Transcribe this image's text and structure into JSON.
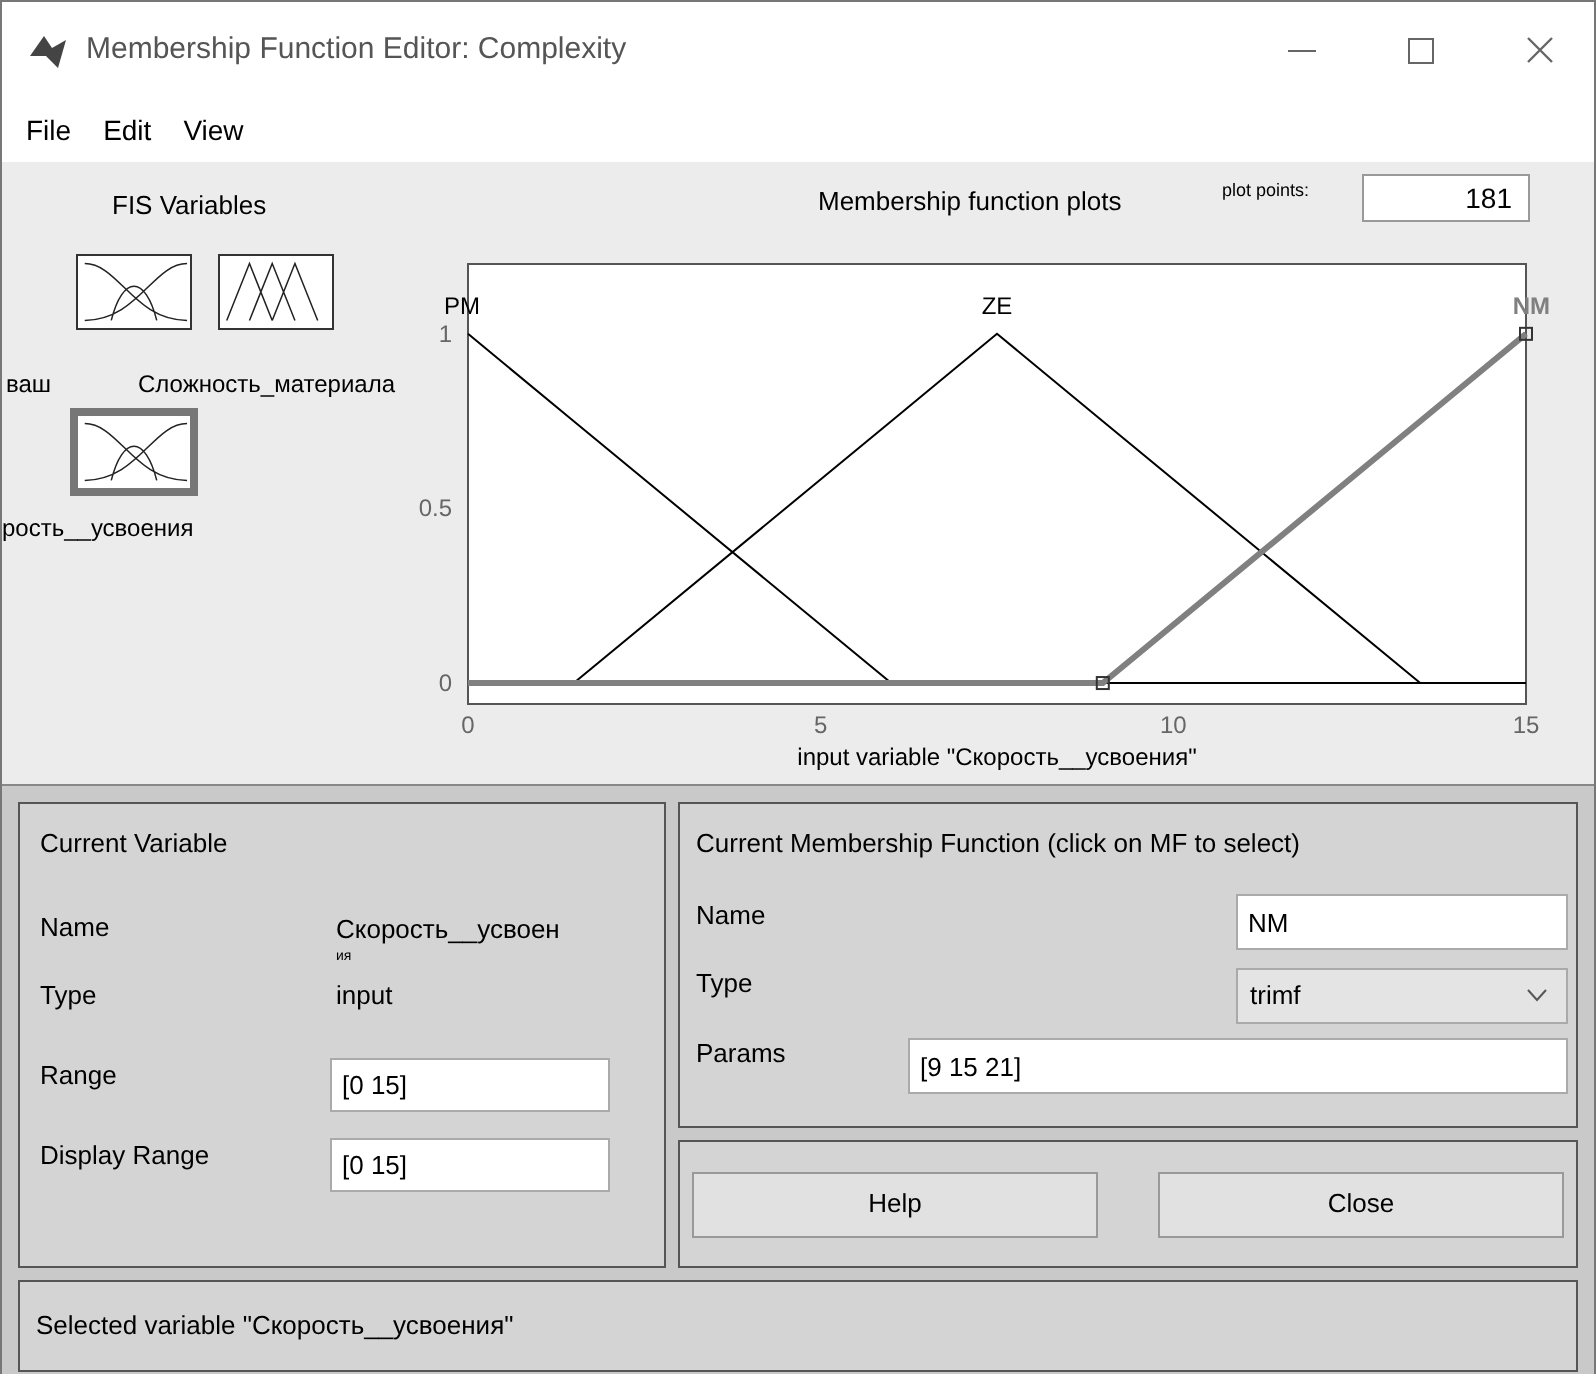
{
  "window": {
    "title": "Membership Function Editor: Complexity"
  },
  "menu": [
    "File",
    "Edit",
    "View"
  ],
  "fis_variables": {
    "title": "FIS Variables",
    "items": [
      {
        "label": "ваш",
        "kind": "input",
        "selected": false
      },
      {
        "label": "Сложность_материала",
        "kind": "output",
        "selected": false
      },
      {
        "label": "рость__усвоения",
        "kind": "input",
        "selected": true
      }
    ]
  },
  "plot": {
    "title": "Membership function plots",
    "plot_points_label": "plot points:",
    "plot_points": "181",
    "membership_functions": [
      {
        "label": "PM",
        "selected": false
      },
      {
        "label": "ZE",
        "selected": false
      },
      {
        "label": "NM",
        "selected": true
      }
    ],
    "chart_data": {
      "type": "line",
      "xlabel": "input variable \"Скорость__усвоения\"",
      "x": [
        0,
        1.5,
        6,
        7.5,
        9,
        13.5,
        15
      ],
      "xlim": [
        0,
        15
      ],
      "ylim": [
        -0.06,
        1.2
      ],
      "xticks": [
        0,
        5,
        10,
        15
      ],
      "yticks": [
        0,
        0.5,
        1
      ],
      "series": [
        {
          "color": "#000000",
          "values": [
            1,
            0.75,
            0,
            0,
            0,
            0,
            0
          ]
        },
        {
          "color": "#000000",
          "values": [
            null,
            0,
            0.75,
            1,
            0.75,
            0,
            null
          ]
        },
        {
          "color": "#808080",
          "values": [
            0,
            0,
            0,
            0,
            0,
            0.75,
            1
          ]
        }
      ]
    }
  },
  "current_variable": {
    "title": "Current Variable",
    "name_label": "Name",
    "name": "Скорость__усвоен",
    "name_overflow": "ия",
    "type_label": "Type",
    "type": "input",
    "range_label": "Range",
    "range": "[0 15]",
    "display_range_label": "Display Range",
    "display_range": "[0 15]"
  },
  "current_mf": {
    "title": "Current Membership Function (click on MF to select)",
    "name_label": "Name",
    "name": "NM",
    "type_label": "Type",
    "type": "trimf",
    "params_label": "Params",
    "params": "[9 15 21]"
  },
  "buttons": [
    "Help",
    "Close"
  ],
  "status": "Selected variable \"Скорость__усвоения\""
}
